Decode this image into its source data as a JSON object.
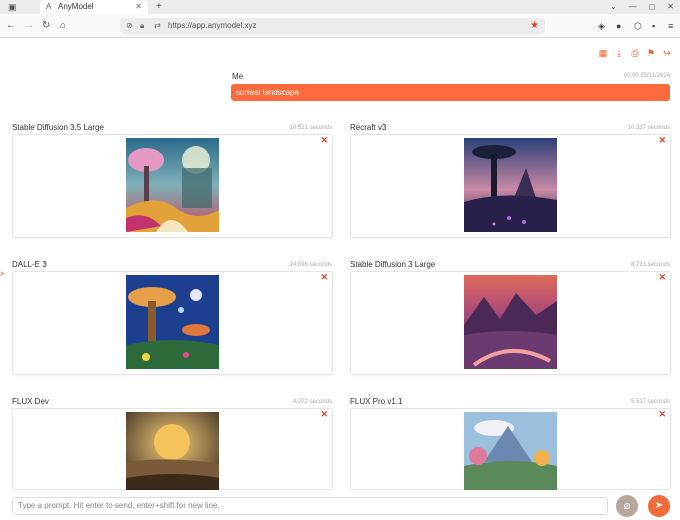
{
  "browser": {
    "tab_title": "AnyModel",
    "url": "https://app.anymodel.xyz",
    "new_tab": "+",
    "window_controls": [
      "⌄",
      "—",
      "◻",
      "✕"
    ]
  },
  "toolbar": {
    "icons": [
      "table-icon",
      "download-icon",
      "print-icon",
      "flag-icon",
      "share-icon"
    ]
  },
  "message": {
    "author": "Me",
    "time": "00:00 23/11/2024",
    "text": "surreal landscape"
  },
  "results": [
    {
      "model": "Stable Diffusion 3.5 Large",
      "time": "10.521 seconds"
    },
    {
      "model": "Recraft v3",
      "time": "10.337 seconds"
    },
    {
      "model": "DALL-E 3",
      "time": "14.098 seconds"
    },
    {
      "model": "Stable Diffusion 3 Large",
      "time": "8.733 seconds"
    },
    {
      "model": "FLUX Dev",
      "time": "4.272 seconds"
    },
    {
      "model": "FLUX Pro v1.1",
      "time": "5.517 seconds"
    }
  ],
  "prompt": {
    "placeholder": "Type a prompt. Hit enter to send, enter+shift for new line."
  },
  "colors": {
    "accent": "#ff6a3d",
    "close": "#e0442b"
  }
}
